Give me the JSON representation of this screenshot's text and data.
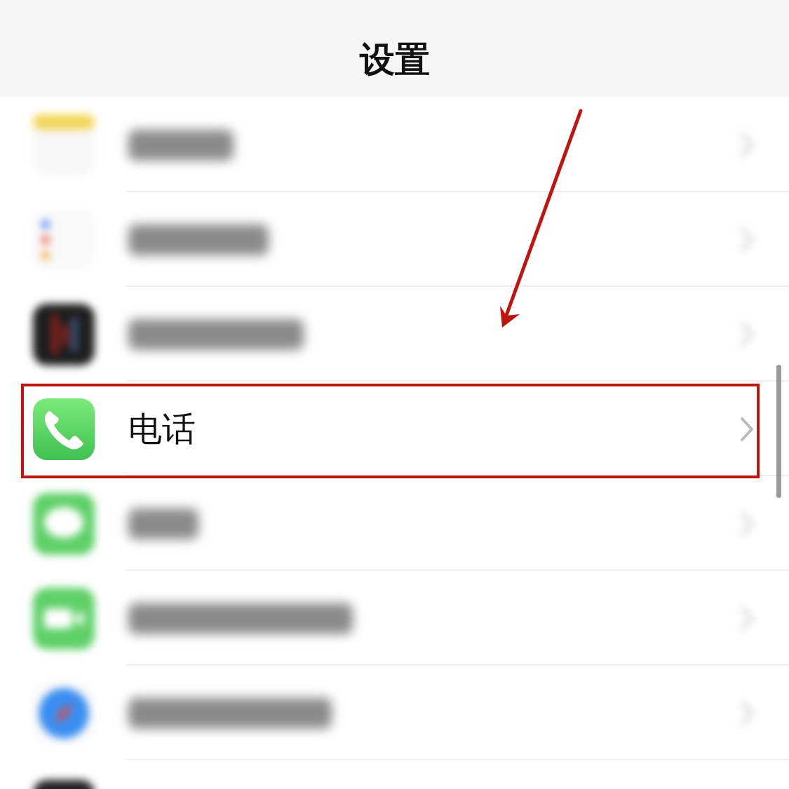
{
  "nav_bar": {
    "title": "设置"
  },
  "rows": [
    {
      "kind": "notes",
      "blurred": true,
      "highlighted": false
    },
    {
      "kind": "reminders",
      "blurred": true,
      "highlighted": false
    },
    {
      "kind": "voice-memos",
      "blurred": true,
      "highlighted": false
    },
    {
      "kind": "phone",
      "label": "电话",
      "blurred": false,
      "highlighted": true
    },
    {
      "kind": "messages",
      "blurred": true,
      "highlighted": false
    },
    {
      "kind": "facetime",
      "blurred": true,
      "highlighted": false
    },
    {
      "kind": "safari",
      "blurred": true,
      "highlighted": false
    },
    {
      "kind": "dark-app",
      "blurred": true,
      "highlighted": false
    }
  ]
}
